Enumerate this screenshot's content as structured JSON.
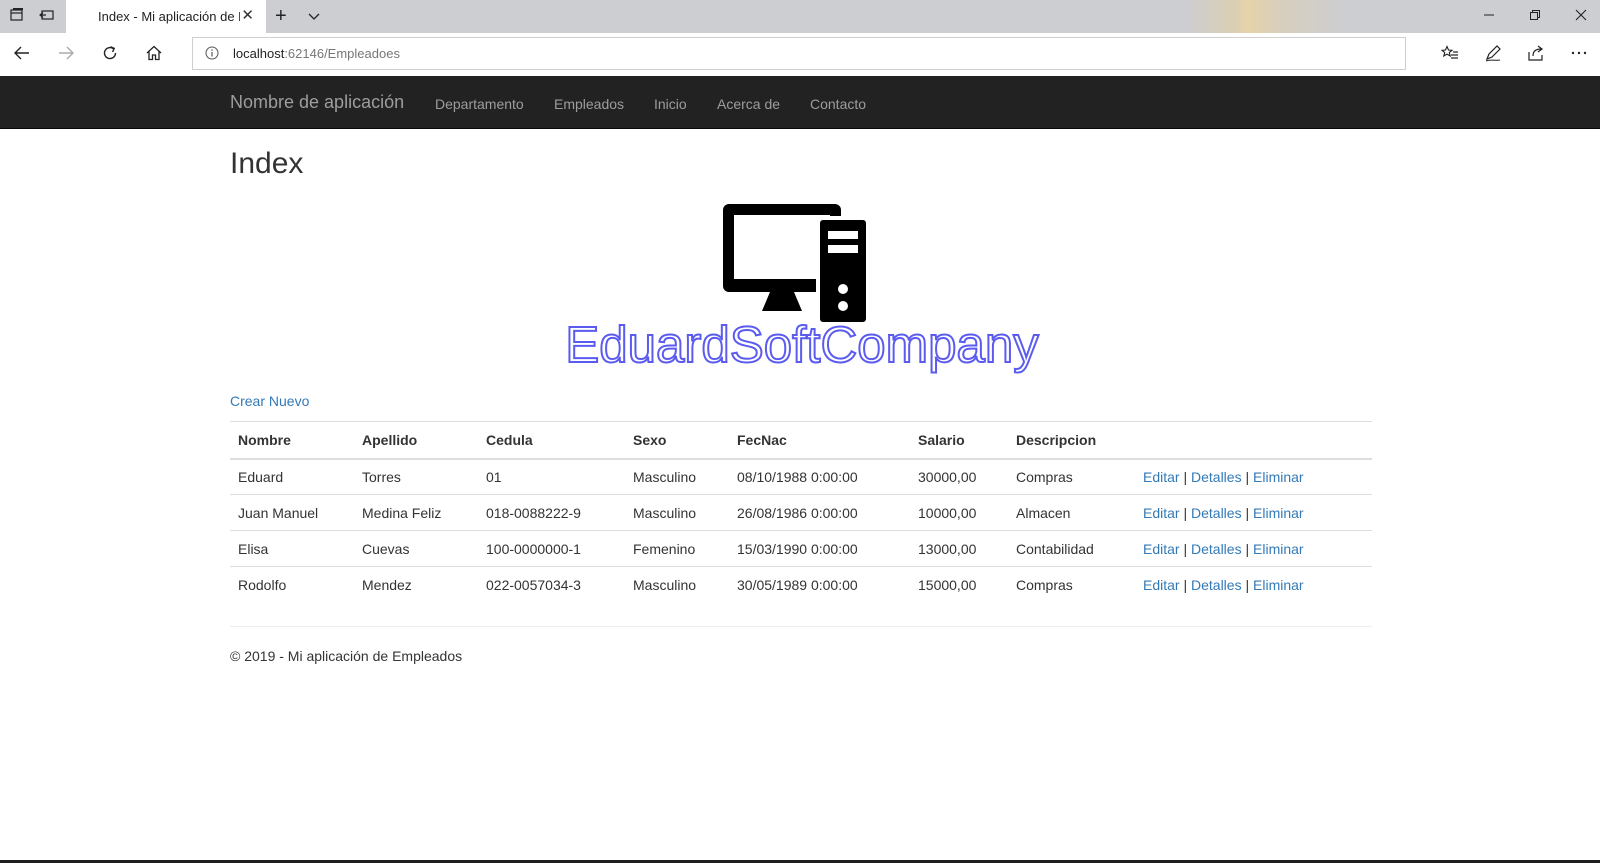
{
  "browser": {
    "tab_title": "Index - Mi aplicación de Empleados",
    "url_host": "localhost",
    "url_rest": ":62146/Empleadoes"
  },
  "site": {
    "brand": "Nombre de aplicación",
    "nav": [
      "Departamento",
      "Empleados",
      "Inicio",
      "Acerca de",
      "Contacto"
    ]
  },
  "page": {
    "title": "Index",
    "logo_text": "EduardSoftCompany",
    "create_link": "Crear Nuevo"
  },
  "table": {
    "headers": [
      "Nombre",
      "Apellido",
      "Cedula",
      "Sexo",
      "FecNac",
      "Salario",
      "Descripcion"
    ],
    "rows": [
      {
        "nombre": "Eduard",
        "apellido": "Torres",
        "cedula": "01",
        "sexo": "Masculino",
        "fecnac": "08/10/1988 0:00:00",
        "salario": "30000,00",
        "descripcion": "Compras"
      },
      {
        "nombre": "Juan Manuel",
        "apellido": "Medina Feliz",
        "cedula": "018-0088222-9",
        "sexo": "Masculino",
        "fecnac": "26/08/1986 0:00:00",
        "salario": "10000,00",
        "descripcion": "Almacen"
      },
      {
        "nombre": "Elisa",
        "apellido": "Cuevas",
        "cedula": "100-0000000-1",
        "sexo": "Femenino",
        "fecnac": "15/03/1990 0:00:00",
        "salario": "13000,00",
        "descripcion": "Contabilidad"
      },
      {
        "nombre": "Rodolfo",
        "apellido": "Mendez",
        "cedula": "022-0057034-3",
        "sexo": "Masculino",
        "fecnac": "30/05/1989 0:00:00",
        "salario": "15000,00",
        "descripcion": "Compras"
      }
    ],
    "actions": {
      "edit": "Editar",
      "details": "Detalles",
      "delete": "Eliminar",
      "separator": "|"
    }
  },
  "footer": {
    "text": "© 2019 - Mi aplicación de Empleados"
  },
  "colors": {
    "navbar_bg": "#222222",
    "nav_text": "#9d9d9d",
    "link": "#337ab7",
    "logo_stroke": "#5b5bf0"
  }
}
